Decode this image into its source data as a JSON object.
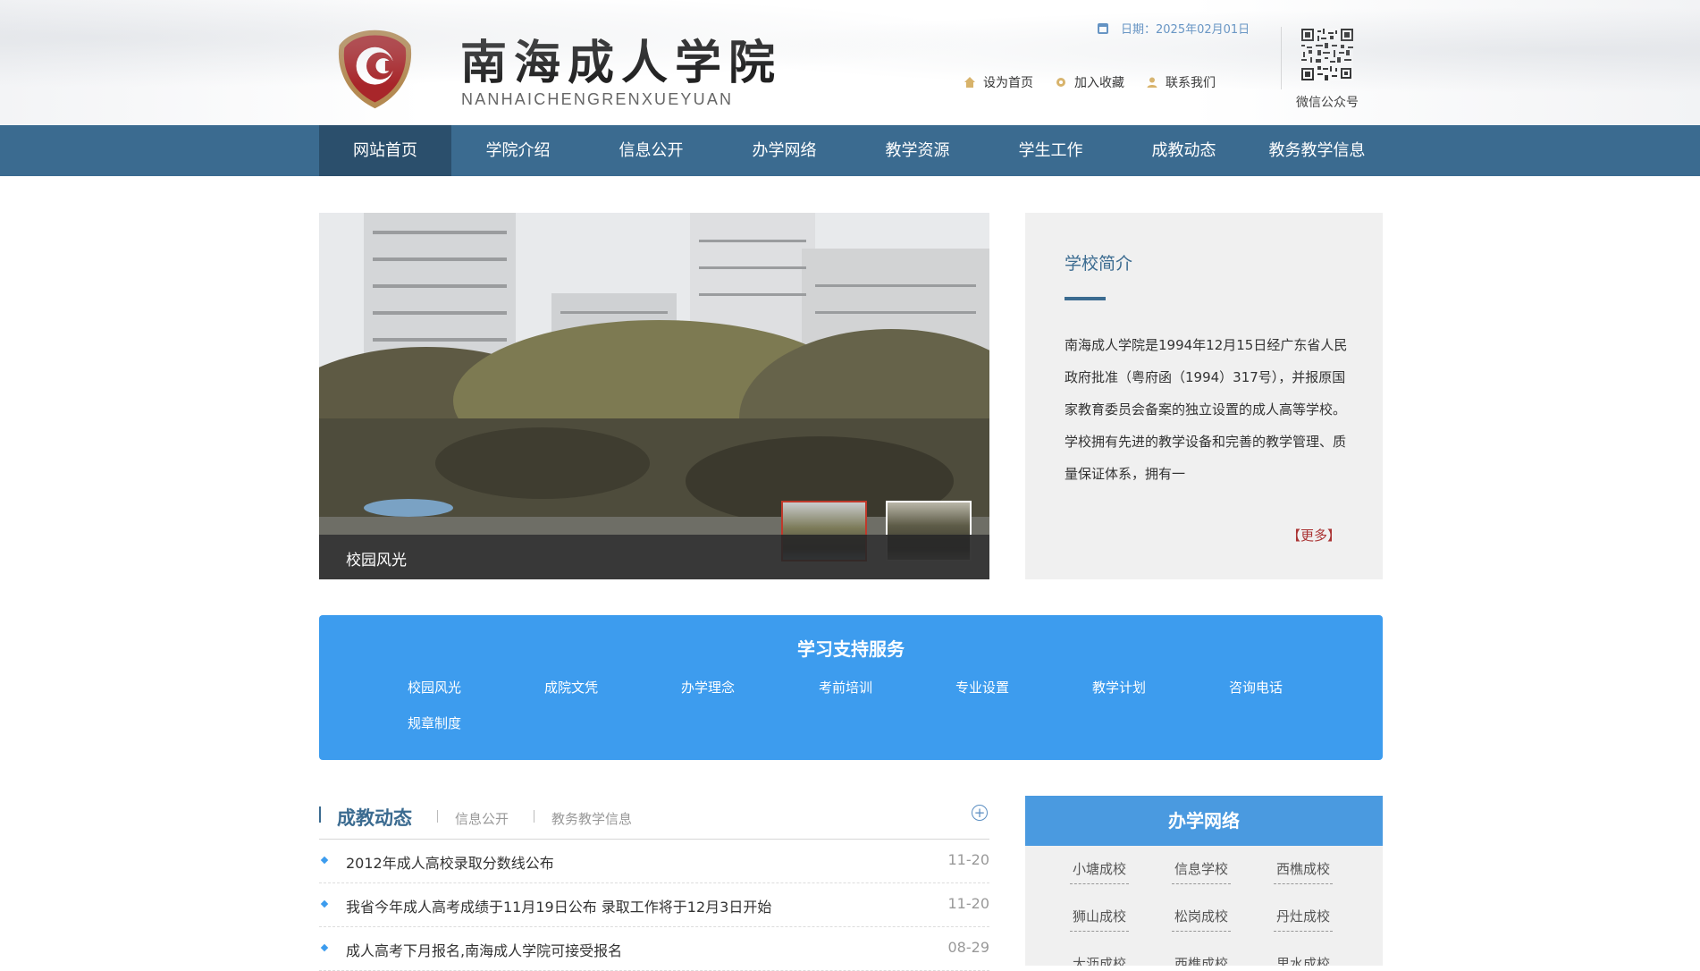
{
  "header": {
    "logo_cn": "南海成人学院",
    "logo_en": "NANHAICHENGRENXUEYUAN",
    "date": "日期：2025年02月01日",
    "links": [
      {
        "label": "设为首页",
        "icon": "home-icon"
      },
      {
        "label": "加入收藏",
        "icon": "star-icon"
      },
      {
        "label": "联系我们",
        "icon": "user-icon"
      }
    ],
    "qr_label": "微信公众号",
    "colors": {
      "nav": "#3b6b90",
      "nav_active": "#2b4f6c",
      "accent": "#3d9cee"
    }
  },
  "nav": {
    "items": [
      "网站首页",
      "学院介绍",
      "信息公开",
      "办学网络",
      "教学资源",
      "学生工作",
      "成教动态",
      "教务教学信息"
    ]
  },
  "slider": {
    "caption": "校园风光"
  },
  "intro": {
    "title": "学校简介",
    "text": "南海成人学院是1994年12月15日经广东省人民政府批准（粤府函（1994）317号），并报原国家教育委员会备案的独立设置的成人高等学校。学校拥有先进的教学设备和完善的教学管理、质量保证体系，拥有一",
    "more": "【更多】"
  },
  "services": {
    "title": "学习支持服务",
    "links": [
      "校园风光",
      "成院文凭",
      "办学理念",
      "考前培训",
      "专业设置",
      "教学计划",
      "咨询电话",
      "规章制度"
    ]
  },
  "news": {
    "tab_main": "成教动态",
    "tab_2": "信息公开",
    "tab_3": "教务教学信息",
    "more_symbol": "+",
    "items": [
      {
        "title": "2012年成人高校录取分数线公布",
        "date": "11-20"
      },
      {
        "title": "我省今年成人高考成绩于11月19日公布 录取工作将于12月3日开始",
        "date": "11-20"
      },
      {
        "title": "成人高考下月报名,南海成人学院可接受报名",
        "date": "08-29"
      }
    ]
  },
  "network": {
    "title": "办学网络",
    "items": [
      "小塘成校",
      "信息学校",
      "西樵成校",
      "狮山成校",
      "松岗成校",
      "丹灶成校",
      "大沥成校",
      "西樵成校",
      "里水成校"
    ]
  }
}
